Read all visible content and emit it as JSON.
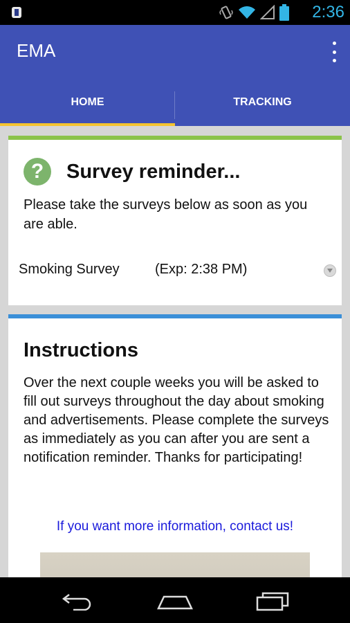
{
  "status_bar": {
    "time": "2:36",
    "icons": [
      "app-notification-icon",
      "vibrate-icon",
      "wifi-icon",
      "signal-icon",
      "battery-icon"
    ],
    "time_color": "#33b5e5"
  },
  "app_bar": {
    "title": "EMA",
    "color": "#3f51b5",
    "tabs": [
      {
        "label": "HOME",
        "selected": true
      },
      {
        "label": "TRACKING",
        "selected": false
      }
    ],
    "indicator_color": "#f4c430"
  },
  "reminder_card": {
    "accent_color": "#8bc34a",
    "icon": "help-icon",
    "title": "Survey reminder...",
    "text": "Please take the surveys below as soon as you are able.",
    "survey": {
      "name": "Smoking Survey",
      "expiry": "(Exp: 2:38 PM)"
    }
  },
  "instructions_card": {
    "accent_color": "#3a8fd8",
    "title": "Instructions",
    "text": "Over the next couple weeks you will be asked to fill out surveys throughout the day about smoking and advertisements. Please complete the surveys as immediately as you can after you are sent a notification reminder.  Thanks for participating!",
    "link": "If you want more information, contact us!"
  },
  "nav_bar": {
    "icons": [
      "back-icon",
      "home-icon",
      "recents-icon"
    ]
  }
}
